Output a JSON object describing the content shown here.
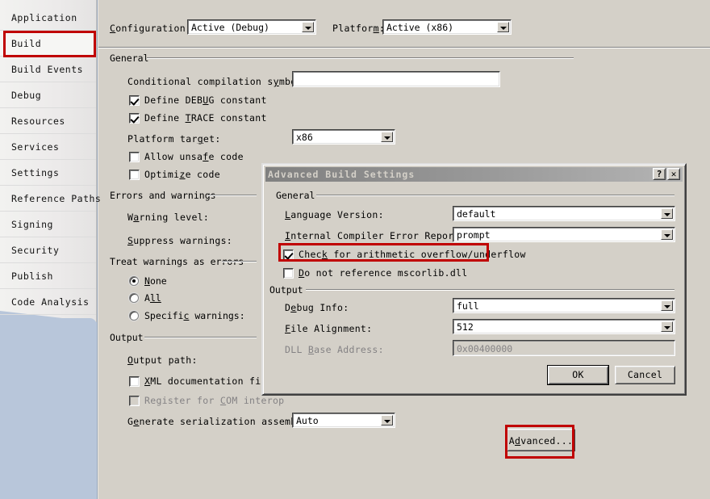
{
  "sidebar": {
    "items": [
      {
        "label": "Application",
        "selected": false
      },
      {
        "label": "Build",
        "selected": true
      },
      {
        "label": "Build Events",
        "selected": false
      },
      {
        "label": "Debug",
        "selected": false
      },
      {
        "label": "Resources",
        "selected": false
      },
      {
        "label": "Services",
        "selected": false
      },
      {
        "label": "Settings",
        "selected": false
      },
      {
        "label": "Reference Paths",
        "selected": false
      },
      {
        "label": "Signing",
        "selected": false
      },
      {
        "label": "Security",
        "selected": false
      },
      {
        "label": "Publish",
        "selected": false
      },
      {
        "label": "Code Analysis",
        "selected": false
      }
    ]
  },
  "build_page": {
    "configuration_label": "Configuration:",
    "configuration_value": "Active (Debug)",
    "platform_label": "Platform:",
    "platform_value": "Active (x86)",
    "general_group": "General",
    "conditional_symbols_label": "Conditional compilation symbols:",
    "conditional_symbols_value": "",
    "define_debug_label": "Define DEBUG constant",
    "define_debug_checked": true,
    "define_trace_label": "Define TRACE constant",
    "define_trace_checked": true,
    "platform_target_label": "Platform target:",
    "platform_target_value": "x86",
    "allow_unsafe_label": "Allow unsafe code",
    "allow_unsafe_checked": false,
    "optimize_label": "Optimize code",
    "optimize_checked": false,
    "errors_group": "Errors and warnings",
    "warning_level_label": "Warning level:",
    "suppress_warnings_label": "Suppress warnings:",
    "treat_group": "Treat warnings as errors",
    "treat_none_label": "None",
    "treat_all_label": "All",
    "treat_specific_label": "Specific warnings:",
    "treat_selected": "None",
    "output_group": "Output",
    "output_path_label": "Output path:",
    "xml_doc_label": "XML documentation file:",
    "xml_doc_checked": false,
    "register_com_label": "Register for COM interop",
    "register_com_checked": false,
    "register_com_disabled": true,
    "gen_serialization_label": "Generate serialization assembly:",
    "gen_serialization_value": "Auto",
    "advanced_button": "Advanced..."
  },
  "dialog": {
    "title": "Advanced Build Settings",
    "help_button": "?",
    "close_button": "✕",
    "general_group": "General",
    "language_version_label": "Language Version:",
    "language_version_value": "default",
    "ice_reporting_label": "Internal Compiler Error Reporting:",
    "ice_reporting_value": "prompt",
    "check_arithmetic_label": "Check for arithmetic overflow/underflow",
    "check_arithmetic_checked": true,
    "no_mscorlib_label": "Do not reference mscorlib.dll",
    "no_mscorlib_checked": false,
    "output_group": "Output",
    "debug_info_label": "Debug Info:",
    "debug_info_value": "full",
    "file_alignment_label": "File Alignment:",
    "file_alignment_value": "512",
    "dll_base_label": "DLL Base Address:",
    "dll_base_value": "0x00400000",
    "dll_base_disabled": true,
    "ok_button": "OK",
    "cancel_button": "Cancel"
  },
  "highlights": {
    "color": "#c00000",
    "targets": [
      "sidebar-item-build",
      "check-arithmetic-overflow-checkbox",
      "advanced-button"
    ]
  },
  "theme": {
    "sidebar_bg": "#b8c6da",
    "panel_bg": "#d4d0c8",
    "strip_bg": "#f0efee",
    "highlight_red": "#c00000",
    "disabled_text": "#848284"
  }
}
